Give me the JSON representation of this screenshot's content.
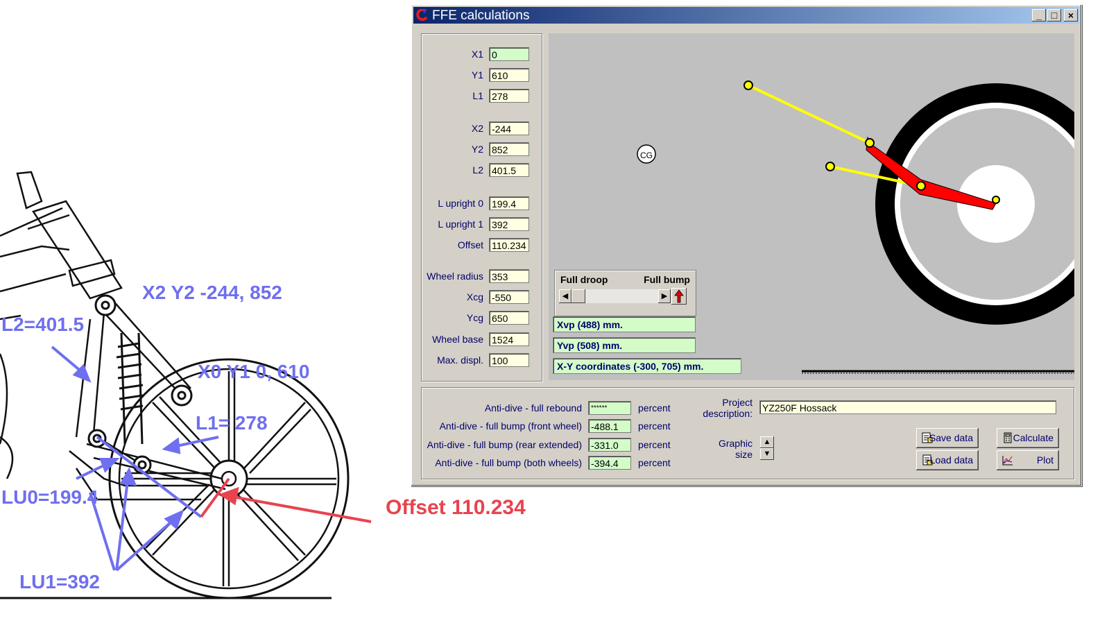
{
  "annotations": {
    "x2y2": "X2 Y2  -244, 852",
    "l2": "L2=401.5",
    "x0y1": "X0 Y1   0, 610",
    "l1": "L1= 278",
    "lu0": "LU0=199.4",
    "lu1": "LU1=392",
    "offset": "Offset 110.234"
  },
  "window": {
    "title": "FFE calculations",
    "controls": [
      "_",
      "□",
      "×"
    ]
  },
  "params": [
    {
      "label": "X1",
      "value": "0",
      "highlight": true
    },
    {
      "label": "Y1",
      "value": "610"
    },
    {
      "label": "L1",
      "value": "278"
    },
    {
      "label": "X2",
      "value": "-244"
    },
    {
      "label": "Y2",
      "value": "852"
    },
    {
      "label": "L2",
      "value": "401.5"
    },
    {
      "label": "L upright 0",
      "value": "199.4"
    },
    {
      "label": "L upright 1",
      "value": "392"
    },
    {
      "label": "Offset",
      "value": "110.234"
    },
    {
      "label": "Wheel radius",
      "value": "353"
    },
    {
      "label": "Xcg",
      "value": "-550"
    },
    {
      "label": "Ycg",
      "value": "650"
    },
    {
      "label": "Wheel base",
      "value": "1524"
    },
    {
      "label": "Max. displ.",
      "value": "100"
    }
  ],
  "graphic": {
    "cg_label": "CG",
    "droop_label": "Full droop",
    "bump_label": "Full bump",
    "xvp": "Xvp (488) mm.",
    "yvp": "Yvp (508) mm.",
    "xy": "X-Y coordinates (-300, 705) mm."
  },
  "antidive": [
    {
      "label": "Anti-dive - full rebound",
      "value": "******",
      "unit": "percent"
    },
    {
      "label": "Anti-dive - full bump (front wheel)",
      "value": "-488.1",
      "unit": "percent"
    },
    {
      "label": "Anti-dive - full bump (rear extended)",
      "value": "-331.0",
      "unit": "percent"
    },
    {
      "label": "Anti-dive - full bump (both wheels)",
      "value": "-394.4",
      "unit": "percent"
    }
  ],
  "project": {
    "label_line1": "Project",
    "label_line2": "description:",
    "value": "YZ250F Hossack"
  },
  "graphic_size": {
    "line1": "Graphic",
    "line2": "size"
  },
  "buttons": {
    "save": "Save data",
    "load": "Load data",
    "calculate": "Calculate",
    "plot": "Plot"
  },
  "colors": {
    "title_start": "#0a246a",
    "title_end": "#a6caf0",
    "field_yellow": "#ffffe1",
    "field_green": "#d3fcc9",
    "link": "#ffff00",
    "upright": "#ff0000",
    "annotation_blue": "#6f6ff0",
    "annotation_red": "#e8434f"
  }
}
